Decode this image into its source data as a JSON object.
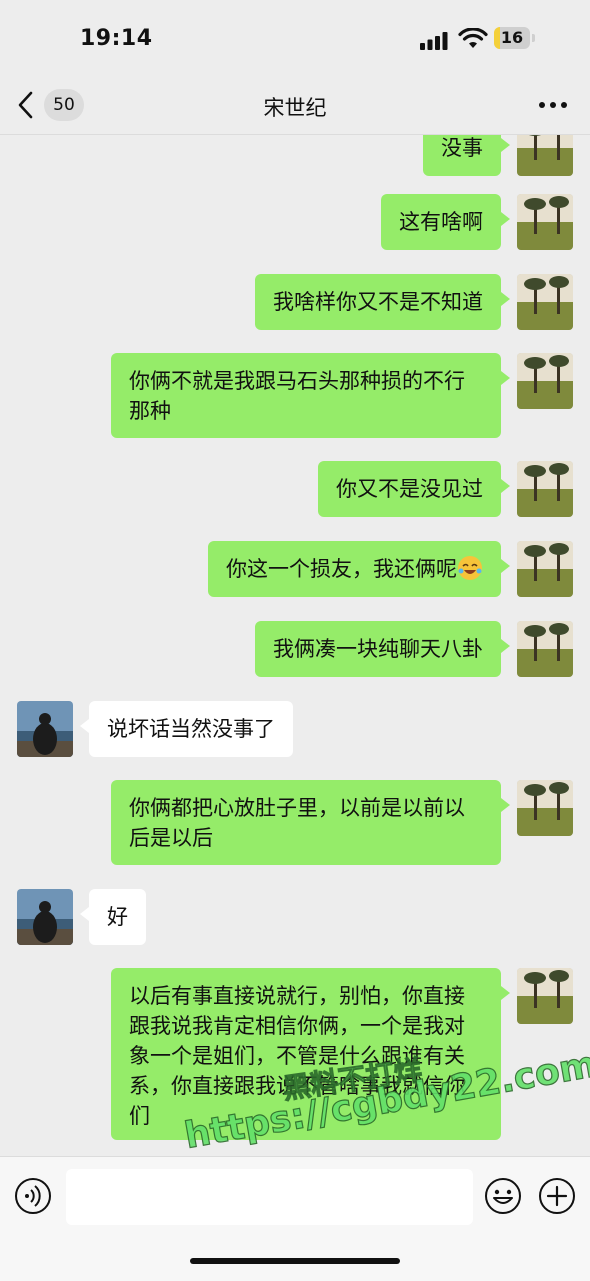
{
  "status": {
    "time": "19:14",
    "battery": "16",
    "battery_level": 0.16
  },
  "nav": {
    "unread": "50",
    "title": "宋世纪"
  },
  "messages": [
    {
      "text": "没事"
    },
    {
      "text": "这有啥啊"
    },
    {
      "text": "我啥样你又不是不知道"
    },
    {
      "text": "你俩不就是我跟马石头那种损的不行那种"
    },
    {
      "text": "你又不是没见过"
    },
    {
      "text": "你这一个损友，我还俩呢"
    },
    {
      "text": "我俩凑一块纯聊天八卦"
    },
    {
      "text": "说坏话当然没事了"
    },
    {
      "text": "你俩都把心放肚子里，以前是以前以后是以后"
    },
    {
      "text": "好"
    },
    {
      "text": "以后有事直接说就行，别怕，你直接跟我说我肯定相信你俩，一个是我对象一个是姐们，不管是什么跟谁有关系，你直接跟我说不管啥事我就信你们"
    }
  ],
  "watermark": {
    "line1": "黑料不打烊",
    "line2": "https://cgbdy22.com"
  },
  "input": {
    "placeholder": ""
  },
  "icons": {
    "back": "chevron-left-icon",
    "more": "more-dots-icon",
    "voice": "voice-icon",
    "emoji": "emoji-icon",
    "plus": "plus-icon",
    "laugh": "laughing-emoji-icon"
  },
  "colors": {
    "mine_bubble": "#95ec69",
    "their_bubble": "#ffffff",
    "background": "#ededed"
  }
}
